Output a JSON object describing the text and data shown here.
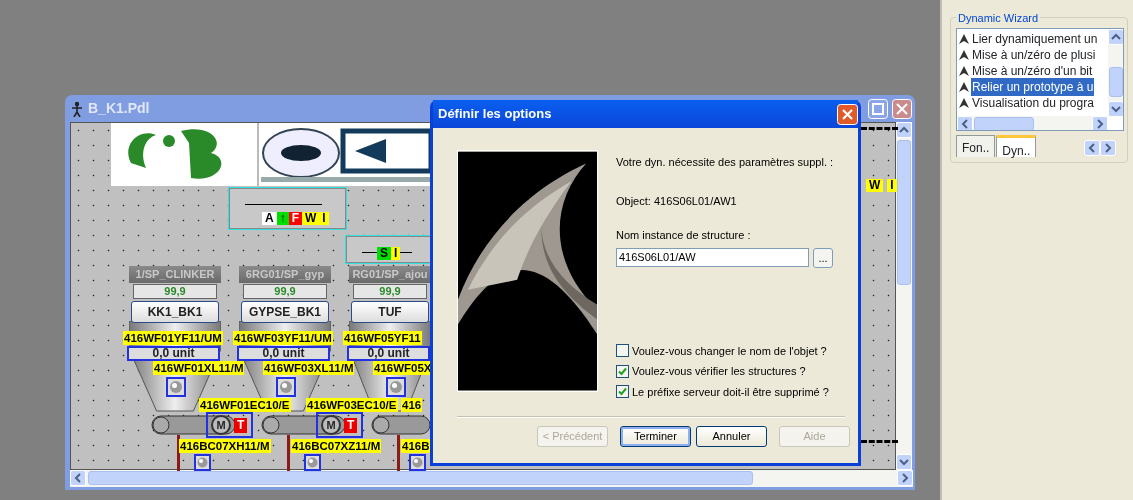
{
  "main_window": {
    "title": "B_K1.Pdl"
  },
  "status_widgets": [
    {
      "indicators": [
        {
          "label": "A",
          "color": "#ffffff"
        },
        {
          "label": "↑",
          "color": "#00dd00"
        },
        {
          "label": "F",
          "color": "#ff0000"
        },
        {
          "label": "W",
          "color": "#ffff00"
        },
        {
          "label": "I",
          "color": "#ffff00"
        }
      ]
    },
    {
      "indicators": [
        {
          "label": "S",
          "color": "#00dd00"
        },
        {
          "label": "I",
          "color": "#ffff00"
        }
      ]
    },
    {
      "indicators": [
        {
          "label": "W",
          "color": "#ffff00"
        },
        {
          "label": "I",
          "color": "#ffff00"
        }
      ]
    }
  ],
  "silos": [
    {
      "tag": "1/SP_CLINKER",
      "value": "99,9",
      "name": "KK1_BK1",
      "flow_tag": "416WF01YF11/UM",
      "flow_value": "0,0 unit",
      "level_tag": "416WF01XL11/M",
      "motor_tag": "416WF01EC10/E",
      "motor_symbol": "M",
      "alarm_symbol": "T",
      "belt_tag": "416BC07XH11/M"
    },
    {
      "tag": "6RG01/SP_gyp",
      "value": "99,9",
      "name": "GYPSE_BK1",
      "flow_tag": "416WF03YF11/UM",
      "flow_value": "0,0 unit",
      "level_tag": "416WF03XL11/M",
      "motor_tag": "416WF03EC10/E",
      "motor_symbol": "M",
      "alarm_symbol": "T",
      "belt_tag": "416BC07XZ11/M"
    },
    {
      "tag": "RG01/SP_ajou",
      "value": "99,9",
      "name": "TUF",
      "flow_tag": "416WF05YF11",
      "flow_value": "0,0 unit",
      "level_tag": "416WF05X",
      "motor_tag": "416",
      "belt_tag": "416B"
    }
  ],
  "dialog": {
    "title": "Définir les options",
    "intro": "Votre dyn. nécessite des paramètres suppl. :",
    "object": "Object: 416S06L01/AW1",
    "structure_label": "Nom instance de structure :",
    "structure_value": "416S06L01/AW",
    "browse": "...",
    "options": [
      {
        "label": "Voulez-vous changer le nom de l'objet ?",
        "checked": false
      },
      {
        "label": "Voulez-vous vérifier les structures ?",
        "checked": true
      },
      {
        "label": "Le préfixe serveur doit-il être supprimé ?",
        "checked": true
      }
    ],
    "buttons": [
      {
        "label": "< Précédent",
        "disabled": true,
        "default": false
      },
      {
        "label": "Terminer",
        "disabled": false,
        "default": true
      },
      {
        "label": "Annuler",
        "disabled": false,
        "default": false
      },
      {
        "label": "Aide",
        "disabled": true,
        "default": false
      }
    ]
  },
  "wizard": {
    "title": "Dynamic Wizard",
    "items": [
      {
        "label": "Lier dynamiquement un",
        "selected": false
      },
      {
        "label": "Mise à un/zéro de plusi",
        "selected": false
      },
      {
        "label": "Mise à un/zéro d'un bit",
        "selected": false
      },
      {
        "label": "Relier un prototype à u",
        "selected": true
      },
      {
        "label": "Visualisation du progra",
        "selected": false
      }
    ],
    "tabs": [
      {
        "label": "Fon..",
        "selected": false
      },
      {
        "label": "Dyn..",
        "selected": true
      }
    ]
  }
}
